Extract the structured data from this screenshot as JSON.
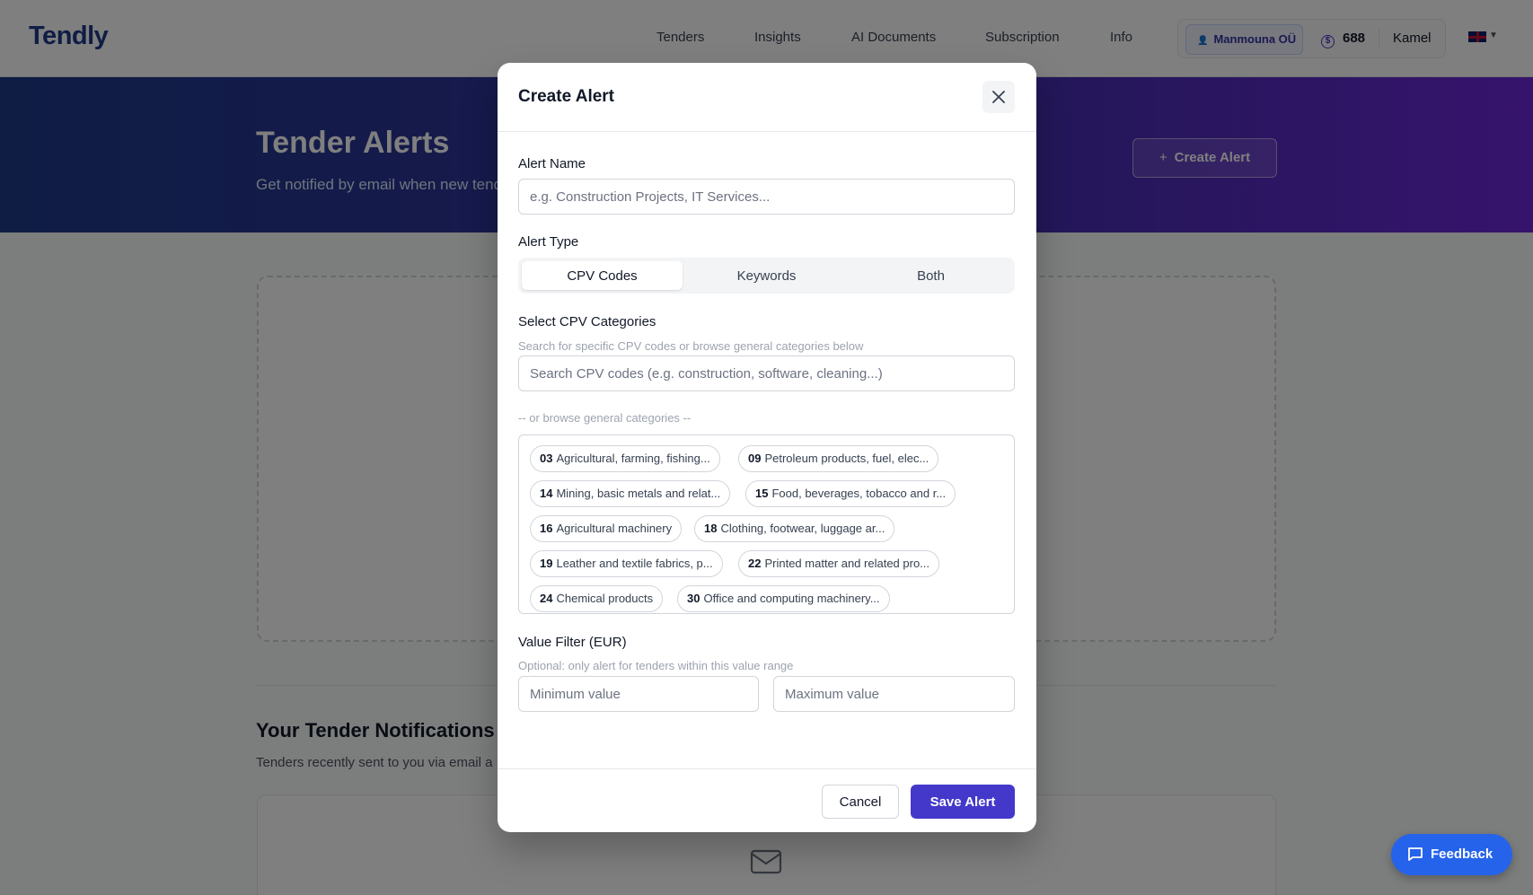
{
  "app": {
    "logo": "Tendly"
  },
  "nav": {
    "items": [
      {
        "label": "Tenders"
      },
      {
        "label": "Insights"
      },
      {
        "label": "AI Documents"
      },
      {
        "label": "Subscription"
      },
      {
        "label": "Info"
      }
    ],
    "company": "Manmouna OÜ",
    "credits": "688",
    "user": "Kamel",
    "language_icon": "uk-flag-icon"
  },
  "hero": {
    "title": "Tender Alerts",
    "subtitle": "Get notified by email when new tende",
    "create_button": "Create Alert"
  },
  "notifications": {
    "title": "Your Tender Notifications",
    "subtitle": "Tenders recently sent to you via email a"
  },
  "feedback": {
    "label": "Feedback"
  },
  "modal": {
    "title": "Create Alert",
    "alert_name": {
      "label": "Alert Name",
      "value": "",
      "placeholder": "e.g. Construction Projects, IT Services..."
    },
    "alert_type": {
      "label": "Alert Type",
      "options": [
        "CPV Codes",
        "Keywords",
        "Both"
      ],
      "selected": "CPV Codes"
    },
    "cpv": {
      "label": "Select CPV Categories",
      "help": "Search for specific CPV codes or browse general categories below",
      "search_placeholder": "Search CPV codes (e.g. construction, software, cleaning...)",
      "browse_label": "-- or browse general categories --",
      "categories": [
        {
          "code": "03",
          "name": "Agricultural, farming, fishing..."
        },
        {
          "code": "09",
          "name": "Petroleum products, fuel, elec..."
        },
        {
          "code": "14",
          "name": "Mining, basic metals and relat..."
        },
        {
          "code": "15",
          "name": "Food, beverages, tobacco and r..."
        },
        {
          "code": "16",
          "name": "Agricultural machinery"
        },
        {
          "code": "18",
          "name": "Clothing, footwear, luggage ar..."
        },
        {
          "code": "19",
          "name": "Leather and textile fabrics, p..."
        },
        {
          "code": "22",
          "name": "Printed matter and related pro..."
        },
        {
          "code": "24",
          "name": "Chemical products"
        },
        {
          "code": "30",
          "name": "Office and computing machinery..."
        }
      ]
    },
    "value_filter": {
      "label": "Value Filter (EUR)",
      "help": "Optional: only alert for tenders within this value range",
      "min_placeholder": "Minimum value",
      "max_placeholder": "Maximum value"
    },
    "cancel_label": "Cancel",
    "save_label": "Save Alert"
  },
  "colors": {
    "brand": "#1e3a8a",
    "primary": "#4338ca",
    "feedback": "#2563eb"
  }
}
